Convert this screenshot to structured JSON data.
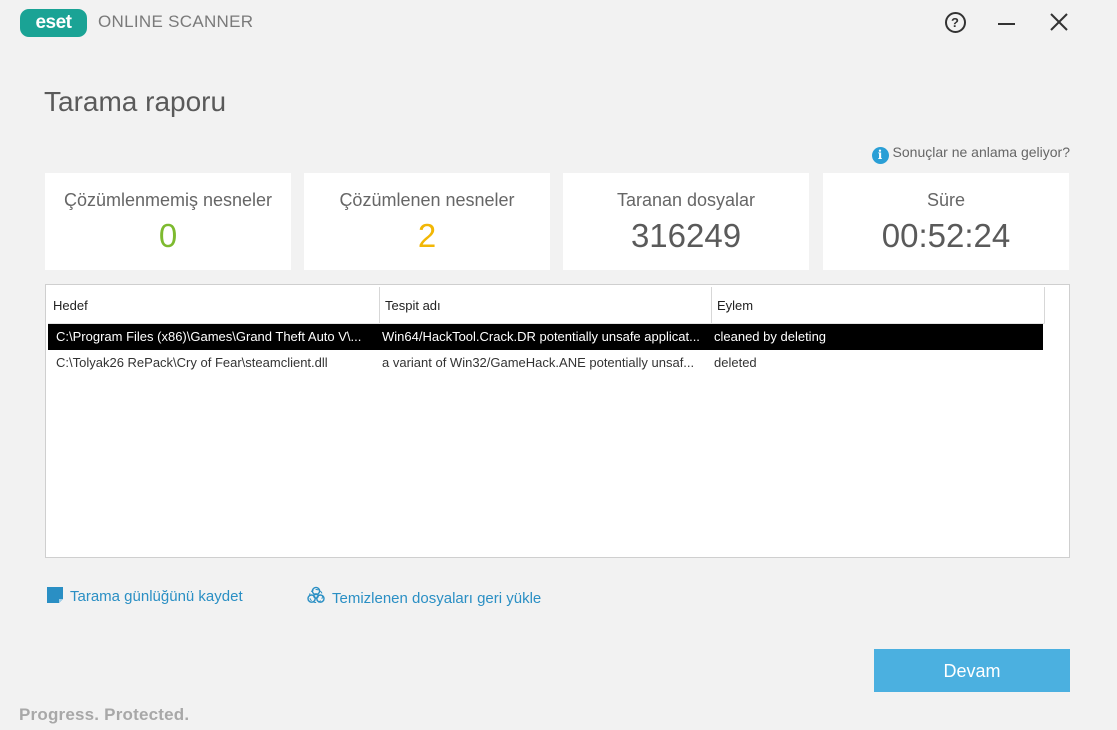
{
  "app": {
    "logo_text": "eset",
    "product_name": "ONLINE SCANNER"
  },
  "window_controls": {
    "help": "?",
    "minimize": "minimize",
    "close": "close"
  },
  "page": {
    "title": "Tarama raporu"
  },
  "info_link": {
    "text": "Sonuçlar ne anlama geliyor?",
    "icon": "info-icon"
  },
  "stats": [
    {
      "label": "Çözümlenmemiş nesneler",
      "value": "0",
      "color": "#7dba2f"
    },
    {
      "label": "Çözümlenen nesneler",
      "value": "2",
      "color": "#f2b705"
    },
    {
      "label": "Taranan dosyalar",
      "value": "316249",
      "color": "#5a5a5a"
    },
    {
      "label": "Süre",
      "value": "00:52:24",
      "color": "#5a5a5a"
    }
  ],
  "table": {
    "columns": [
      "Hedef",
      "Tespit adı",
      "Eylem"
    ],
    "rows": [
      {
        "target": "C:\\Program Files (x86)\\Games\\Grand Theft Auto V\\...",
        "detection": "Win64/HackTool.Crack.DR potentially unsafe applicat...",
        "action": "cleaned by deleting",
        "selected": true
      },
      {
        "target": "C:\\Tolyak26 RePack\\Cry of Fear\\steamclient.dll",
        "detection": "a variant of Win32/GameHack.ANE potentially unsaf...",
        "action": "deleted",
        "selected": false
      }
    ]
  },
  "actions": {
    "save_log": "Tarama günlüğünü kaydet",
    "restore_files": "Temizlenen dosyaları geri yükle"
  },
  "continue_button": "Devam",
  "footer": "Progress. Protected."
}
